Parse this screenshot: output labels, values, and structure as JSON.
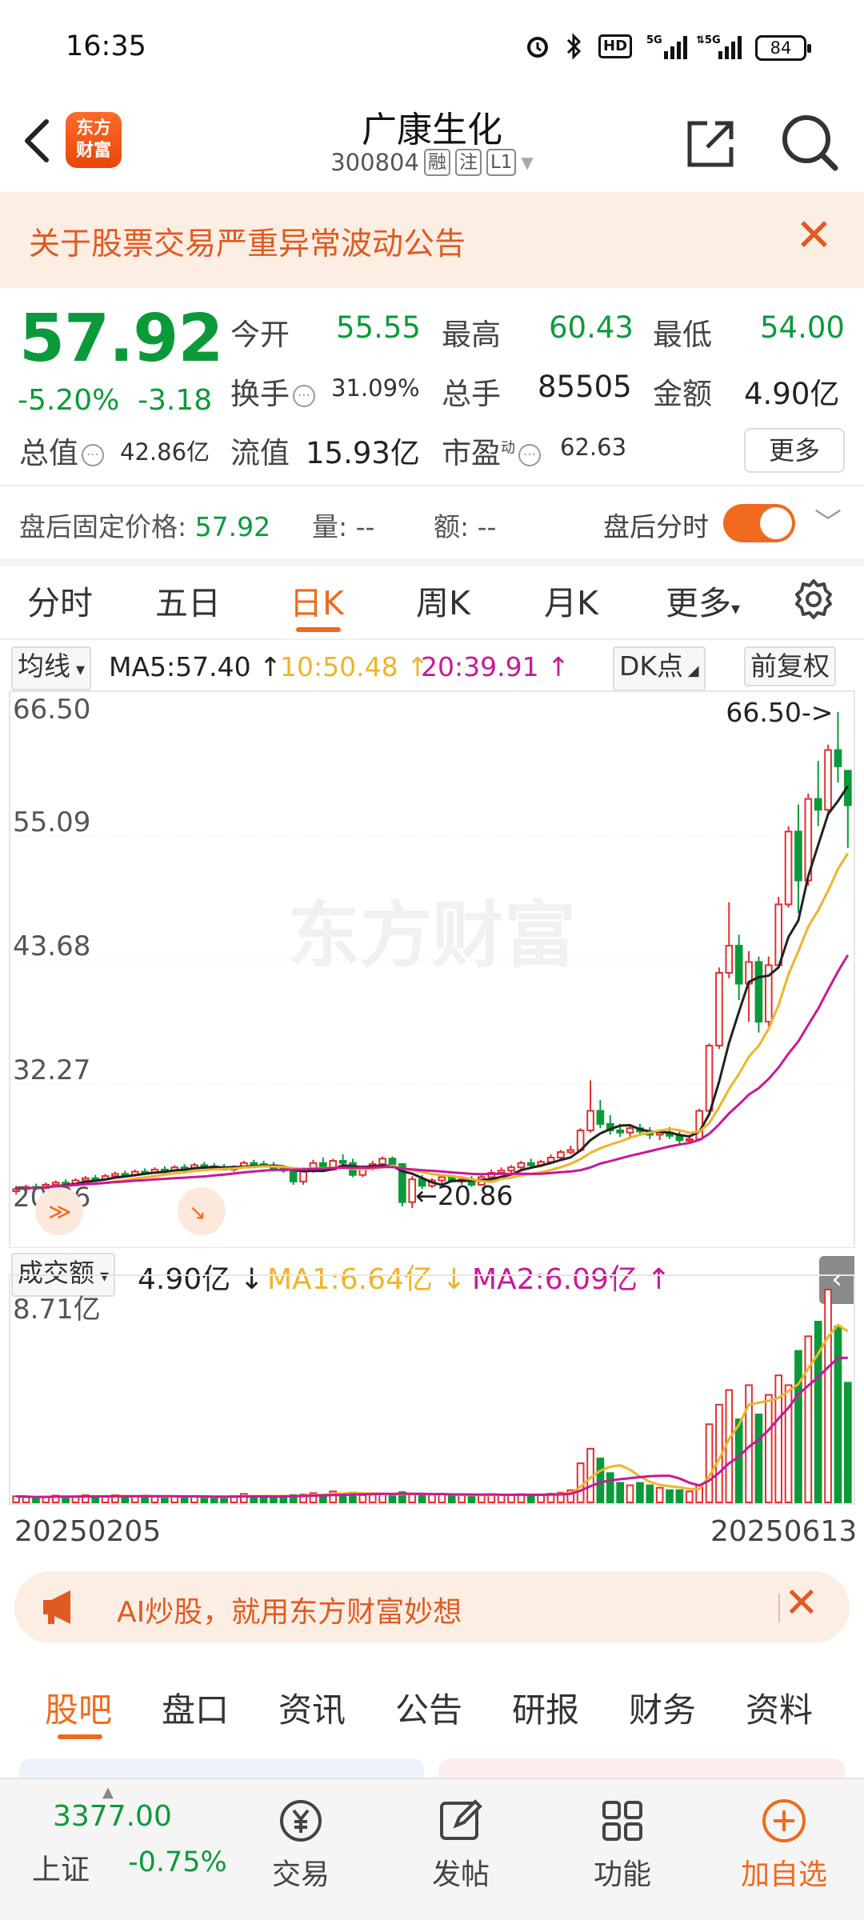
{
  "status_bar": {
    "time": "16:35",
    "battery": "84",
    "network": "5G",
    "hd": "HD"
  },
  "header": {
    "logo_line1": "东方",
    "logo_line2": "财富",
    "stock_name": "广康生化",
    "stock_code": "300804",
    "tags": [
      "融",
      "注",
      "L1"
    ]
  },
  "notice": {
    "text": "关于股票交易严重异常波动公告"
  },
  "quote": {
    "price": "57.92",
    "change_pct": "-5.20%",
    "change_amt": "-3.18",
    "open_label": "今开",
    "open": "55.55",
    "high_label": "最高",
    "high": "60.43",
    "low_label": "最低",
    "low": "54.00",
    "turnover_label": "换手",
    "turnover": "31.09%",
    "volume_label": "总手",
    "volume": "85505",
    "amount_label": "金额",
    "amount": "4.90亿",
    "mktcap_label": "总值",
    "mktcap": "42.86亿",
    "float_label": "流值",
    "float": "15.93亿",
    "pe_label": "市盈",
    "pe_sup": "动",
    "pe": "62.63",
    "more_label": "更多"
  },
  "after_hours": {
    "price_label": "盘后固定价格:",
    "price": "57.92",
    "vol_label": "量: --",
    "amt_label": "额: --",
    "timeshare_label": "盘后分时"
  },
  "kline_tabs": [
    "分时",
    "五日",
    "日K",
    "周K",
    "月K",
    "更多"
  ],
  "active_kline_tab": "日K",
  "ma_bar": {
    "selector": "均线",
    "ma5": "MA5:57.40",
    "ma10": "10:50.48",
    "ma20": "20:39.91",
    "dk_label": "DK点",
    "adjust_label": "前复权"
  },
  "volume_bar": {
    "selector": "成交额",
    "value": "4.90亿",
    "ma1": "MA1:6.64亿",
    "ma2": "MA2:6.09亿",
    "max_label": "8.71亿"
  },
  "watermark": "东方财富",
  "colors": {
    "up": "#e03030",
    "down": "#0b9a3a",
    "ma5": "#222222",
    "ma10": "#f0b429",
    "ma20": "#c8189a",
    "accent": "#f06a1e"
  },
  "chart_data": {
    "type": "candlestick",
    "y_ticks": [
      "66.50",
      "55.09",
      "43.68",
      "32.27",
      "20.86"
    ],
    "ylim": [
      20.86,
      66.5
    ],
    "high_marker": "66.50->",
    "low_marker": "20.86",
    "x_start": "20250205",
    "x_end": "20250613",
    "candles": [
      [
        22.4,
        22.9,
        22.1,
        22.6
      ],
      [
        22.6,
        23.0,
        22.3,
        22.8
      ],
      [
        22.8,
        23.1,
        22.5,
        22.7
      ],
      [
        22.7,
        23.2,
        22.6,
        23.0
      ],
      [
        23.0,
        23.4,
        22.8,
        23.2
      ],
      [
        23.2,
        23.5,
        22.9,
        23.1
      ],
      [
        23.1,
        23.6,
        23.0,
        23.4
      ],
      [
        23.4,
        23.8,
        23.2,
        23.6
      ],
      [
        23.6,
        23.9,
        23.3,
        23.5
      ],
      [
        23.5,
        24.0,
        23.4,
        23.8
      ],
      [
        23.8,
        24.2,
        23.6,
        24.0
      ],
      [
        24.0,
        24.3,
        23.7,
        23.9
      ],
      [
        23.9,
        24.4,
        23.8,
        24.2
      ],
      [
        24.2,
        24.5,
        23.9,
        24.1
      ],
      [
        24.1,
        24.6,
        24.0,
        24.4
      ],
      [
        24.4,
        24.7,
        24.1,
        24.3
      ],
      [
        24.3,
        24.8,
        24.2,
        24.6
      ],
      [
        24.6,
        24.9,
        24.3,
        24.5
      ],
      [
        24.5,
        25.0,
        24.4,
        24.8
      ],
      [
        24.8,
        25.1,
        24.5,
        24.7
      ],
      [
        24.7,
        25.0,
        24.4,
        24.6
      ],
      [
        24.6,
        24.9,
        24.3,
        24.4
      ],
      [
        24.4,
        24.8,
        24.2,
        24.6
      ],
      [
        24.6,
        25.2,
        24.5,
        25.0
      ],
      [
        25.0,
        25.3,
        24.7,
        24.9
      ],
      [
        24.9,
        25.2,
        24.6,
        24.8
      ],
      [
        24.8,
        25.1,
        24.4,
        24.5
      ],
      [
        24.5,
        24.8,
        24.1,
        24.3
      ],
      [
        24.3,
        24.6,
        23.0,
        23.3
      ],
      [
        23.3,
        24.6,
        23.0,
        24.3
      ],
      [
        24.3,
        25.3,
        24.1,
        25.0
      ],
      [
        25.0,
        25.5,
        24.2,
        24.4
      ],
      [
        24.4,
        25.4,
        24.3,
        25.2
      ],
      [
        25.2,
        25.8,
        24.8,
        25.0
      ],
      [
        25.0,
        25.4,
        23.7,
        23.9
      ],
      [
        23.9,
        24.8,
        23.7,
        24.6
      ],
      [
        24.6,
        25.2,
        24.3,
        24.9
      ],
      [
        24.9,
        25.6,
        24.8,
        25.4
      ],
      [
        25.4,
        25.6,
        24.8,
        24.9
      ],
      [
        24.9,
        25.0,
        21.0,
        21.4
      ],
      [
        21.4,
        23.8,
        20.86,
        23.5
      ],
      [
        23.5,
        23.9,
        22.6,
        22.9
      ],
      [
        22.9,
        23.6,
        22.7,
        23.4
      ],
      [
        23.4,
        23.9,
        23.1,
        23.7
      ],
      [
        23.7,
        23.9,
        23.2,
        23.3
      ],
      [
        23.3,
        23.7,
        23.0,
        23.5
      ],
      [
        23.5,
        23.8,
        22.8,
        23.0
      ],
      [
        23.0,
        23.9,
        22.9,
        23.7
      ],
      [
        23.7,
        24.4,
        23.6,
        24.1
      ],
      [
        24.1,
        24.6,
        23.9,
        24.3
      ],
      [
        24.3,
        24.8,
        24.1,
        24.6
      ],
      [
        24.6,
        25.2,
        24.4,
        25.0
      ],
      [
        25.0,
        25.4,
        24.6,
        24.8
      ],
      [
        24.8,
        25.3,
        24.6,
        25.1
      ],
      [
        25.1,
        25.8,
        25.0,
        25.5
      ],
      [
        25.5,
        26.2,
        25.3,
        26.0
      ],
      [
        26.0,
        26.6,
        25.8,
        26.2
      ],
      [
        26.2,
        28.2,
        26.0,
        28.0
      ],
      [
        28.0,
        32.6,
        27.8,
        29.8
      ],
      [
        29.8,
        30.8,
        28.2,
        28.6
      ],
      [
        28.6,
        29.4,
        27.6,
        28.0
      ],
      [
        28.0,
        28.6,
        27.4,
        27.8
      ],
      [
        27.8,
        28.4,
        27.3,
        28.2
      ],
      [
        28.2,
        28.6,
        27.6,
        27.9
      ],
      [
        27.9,
        28.3,
        27.2,
        27.6
      ],
      [
        27.6,
        28.1,
        27.1,
        27.8
      ],
      [
        27.8,
        28.3,
        27.2,
        27.5
      ],
      [
        27.5,
        27.9,
        26.8,
        27.1
      ],
      [
        27.1,
        27.6,
        26.8,
        27.2
      ],
      [
        27.2,
        30.0,
        27.0,
        29.8
      ],
      [
        29.8,
        36.0,
        29.6,
        35.8
      ],
      [
        35.8,
        43.0,
        35.5,
        42.5
      ],
      [
        42.5,
        49.0,
        42.0,
        45.0
      ],
      [
        45.0,
        46.0,
        40.0,
        41.5
      ],
      [
        41.5,
        44.5,
        38.0,
        43.5
      ],
      [
        43.5,
        44.0,
        37.0,
        38.0
      ],
      [
        38.0,
        44.0,
        37.5,
        43.2
      ],
      [
        43.2,
        49.5,
        43.0,
        48.8
      ],
      [
        48.8,
        56.0,
        48.5,
        55.5
      ],
      [
        55.5,
        58.0,
        48.0,
        51.0
      ],
      [
        51.0,
        59.0,
        50.5,
        58.5
      ],
      [
        58.5,
        62.0,
        56.0,
        57.5
      ],
      [
        57.5,
        63.5,
        57.0,
        63.0
      ],
      [
        63.0,
        66.5,
        60.0,
        61.5
      ],
      [
        61.1,
        60.43,
        54.0,
        57.92
      ]
    ],
    "volume_ylim": [
      0,
      8.71
    ],
    "volumes": [
      0.25,
      0.22,
      0.2,
      0.24,
      0.28,
      0.22,
      0.25,
      0.3,
      0.22,
      0.26,
      0.3,
      0.22,
      0.24,
      0.28,
      0.24,
      0.22,
      0.25,
      0.22,
      0.26,
      0.22,
      0.2,
      0.22,
      0.26,
      0.35,
      0.24,
      0.22,
      0.24,
      0.26,
      0.3,
      0.32,
      0.38,
      0.3,
      0.45,
      0.36,
      0.4,
      0.3,
      0.32,
      0.36,
      0.28,
      0.42,
      0.36,
      0.3,
      0.32,
      0.34,
      0.28,
      0.3,
      0.28,
      0.32,
      0.34,
      0.3,
      0.32,
      0.34,
      0.3,
      0.32,
      0.36,
      0.4,
      0.5,
      1.6,
      2.2,
      1.8,
      1.2,
      0.8,
      0.7,
      0.8,
      0.7,
      0.6,
      0.5,
      0.5,
      0.45,
      0.7,
      3.2,
      4.0,
      4.6,
      3.4,
      4.8,
      3.6,
      4.4,
      5.2,
      4.8,
      6.2,
      6.8,
      7.4,
      8.71,
      7.2,
      4.9
    ]
  }
}
